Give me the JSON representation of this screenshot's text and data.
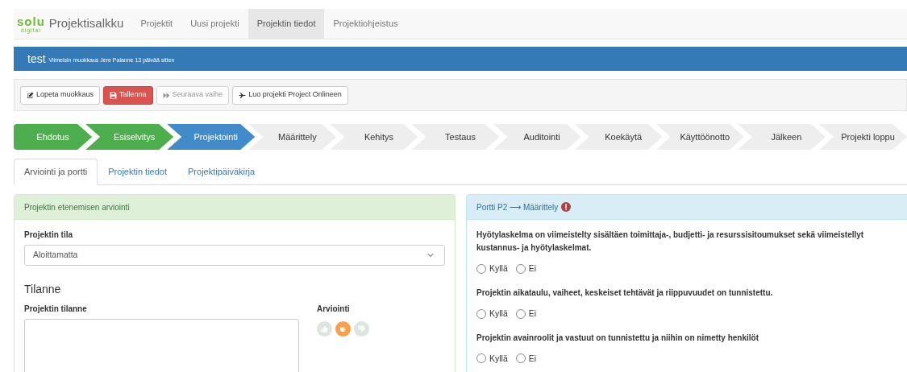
{
  "navbar": {
    "logo_text": "solu",
    "logo_subtext": "digital",
    "brand": "Projektisalkku",
    "links": [
      {
        "label": "Projektit",
        "selected": false
      },
      {
        "label": "Uusi projekti",
        "selected": false
      },
      {
        "label": "Projektin tiedot",
        "selected": true
      },
      {
        "label": "Projektiohjeistus",
        "selected": false
      }
    ]
  },
  "header": {
    "title": "test",
    "subtitle": "Viimeisin muokkaus Jere Palanne 13 päivää sitten"
  },
  "toolbar": [
    {
      "label": "Lopeta muokkaus",
      "kind": "edit",
      "disabled": false
    },
    {
      "label": "Tallenna",
      "kind": "save",
      "disabled": false
    },
    {
      "label": "Seuraava vaihe",
      "kind": "next",
      "disabled": true
    },
    {
      "label": "Luo projekti Project Onlineen",
      "kind": "plane",
      "disabled": false
    }
  ],
  "steps": [
    {
      "label": "Ehdotus",
      "done": true,
      "current": false
    },
    {
      "label": "Esiselvitys",
      "done": true,
      "current": false
    },
    {
      "label": "Projektointi",
      "done": false,
      "current": true
    },
    {
      "label": "Määrittely",
      "done": false,
      "current": false
    },
    {
      "label": "Kehitys",
      "done": false,
      "current": false
    },
    {
      "label": "Testaus",
      "done": false,
      "current": false
    },
    {
      "label": "Auditointi",
      "done": false,
      "current": false
    },
    {
      "label": "Koekäytä",
      "done": false,
      "current": false
    },
    {
      "label": "Käyttöönotto",
      "done": false,
      "current": false
    },
    {
      "label": "Jälkeen",
      "done": false,
      "current": false
    },
    {
      "label": "Projekti loppu",
      "done": false,
      "current": false
    }
  ],
  "tabs": [
    {
      "label": "Arviointi ja portti",
      "selected": true
    },
    {
      "label": "Projektin tiedot",
      "selected": false
    },
    {
      "label": "Projektipäiväkirja",
      "selected": false
    }
  ],
  "assessment_panel": {
    "title": "Projektin etenemisen arviointi",
    "status_label": "Projektin tila",
    "status_value": "Aloittamatta",
    "section_title": "Tilanne",
    "situation_label": "Projektin tilanne",
    "rating_label": "Arviointi",
    "ratings": [
      {
        "kind": "up",
        "selected": false
      },
      {
        "kind": "middle",
        "selected": true
      },
      {
        "kind": "down",
        "selected": false
      }
    ]
  },
  "gate_panel": {
    "title": "Portti P2 ⟶ Määrittely",
    "warning": true,
    "questions": [
      {
        "text": "Hyötylaskelma on viimeistelty sisältäen toimittaja-, budjetti- ja resurssisitoumukset sekä viimeistellyt kustannus- ja hyötylaskelmat.",
        "options": [
          {
            "label": "Kyllä",
            "checked": false
          },
          {
            "label": "Ei",
            "checked": false
          }
        ]
      },
      {
        "text": "Projektin aikataulu, vaiheet, keskeiset tehtävät ja riippuvuudet on tunnistettu.",
        "options": [
          {
            "label": "Kyllä",
            "checked": false
          },
          {
            "label": "Ei",
            "checked": false
          }
        ]
      },
      {
        "text": "Projektin avainroolit ja vastuut on tunnistettu ja niihin on nimetty henkilöt",
        "options": [
          {
            "label": "Kyllä",
            "checked": false
          },
          {
            "label": "Ei",
            "checked": false
          }
        ]
      }
    ]
  }
}
